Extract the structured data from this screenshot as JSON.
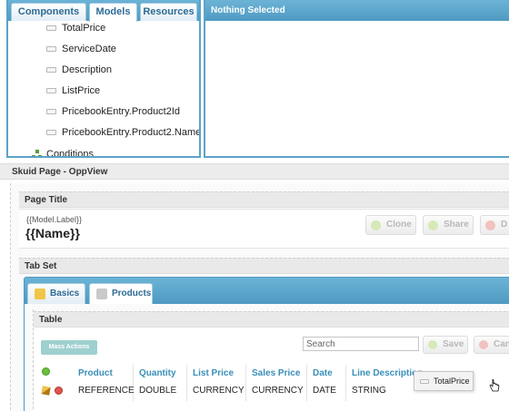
{
  "builder": {
    "tabs": [
      "Components",
      "Models",
      "Resources"
    ],
    "active_tab": "Models",
    "fields": [
      "TotalPrice",
      "ServiceDate",
      "Description",
      "ListPrice",
      "PricebookEntry.Product2Id",
      "PricebookEntry.Product2.Name"
    ],
    "conditions_label": "Conditions"
  },
  "right_panel": {
    "title": "Nothing Selected"
  },
  "page": {
    "name": "Skuid Page - OppView",
    "page_title_component": "Page Title",
    "model_label_template": "{{Model.Label}}",
    "name_template": "{{Name}}",
    "actions": [
      "Clone",
      "Share",
      "D"
    ],
    "tab_set_component": "Tab Set",
    "tabs": [
      "Basics",
      "Products"
    ],
    "active_tab": "Products",
    "table_component": "Table",
    "mass_actions_label": "Mass Actions",
    "search_placeholder": "Search",
    "save_label": "Save",
    "cancel_label": "Can",
    "columns": [
      {
        "header": "Product",
        "value": "REFERENCE"
      },
      {
        "header": "Quantity",
        "value": "DOUBLE"
      },
      {
        "header": "List Price",
        "value": "CURRENCY"
      },
      {
        "header": "Sales Price",
        "value": "CURRENCY"
      },
      {
        "header": "Date",
        "value": "DATE"
      },
      {
        "header": "Line Description",
        "value": "STRING"
      }
    ],
    "drag_field_label": "TotalPrice"
  },
  "colors": {
    "accent": "#4f9ac2",
    "header_text": "#3a8fb8"
  }
}
